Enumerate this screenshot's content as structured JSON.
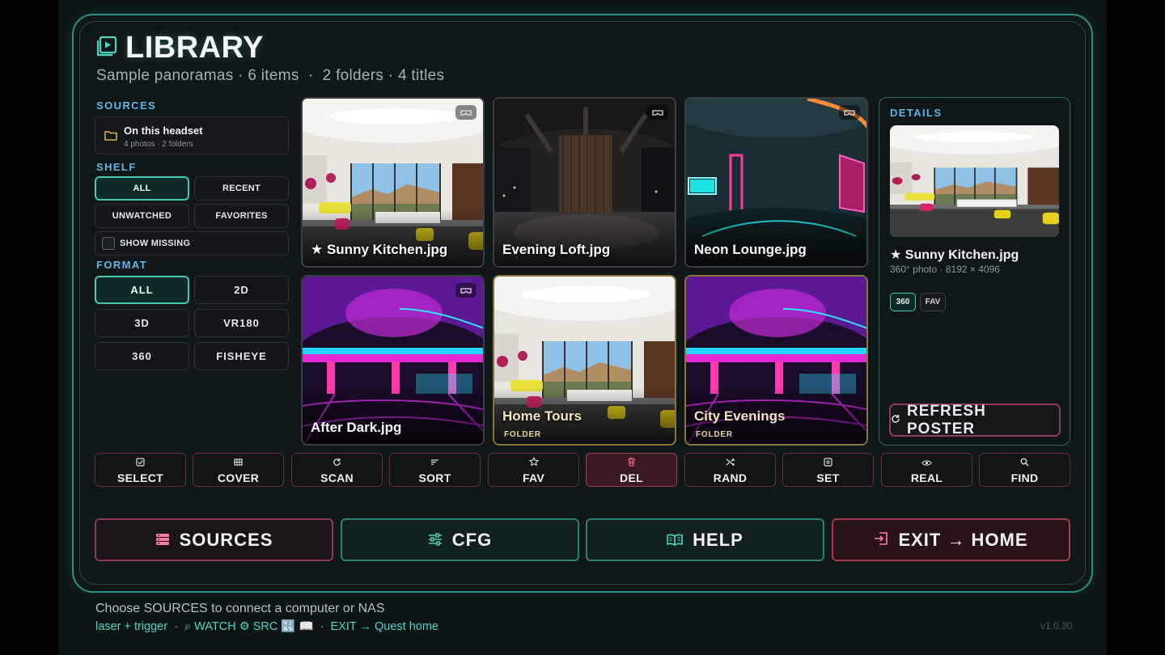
{
  "header": {
    "title": "LIBRARY",
    "subtitle": "Sample panoramas · 6 items  ·  2 folders · 4 titles"
  },
  "sidebar": {
    "sources_label": "SOURCES",
    "source": {
      "name": "On this headset",
      "meta": "4 photos · 2 folders"
    },
    "shelf_label": "SHELF",
    "shelf": [
      {
        "label": "ALL",
        "active": true
      },
      {
        "label": "RECENT",
        "active": false
      },
      {
        "label": "UNWATCHED",
        "active": false
      },
      {
        "label": "FAVORITES",
        "active": false
      }
    ],
    "show_missing": "SHOW MISSING",
    "format_label": "FORMAT",
    "formats": [
      {
        "label": "ALL",
        "active": true
      },
      {
        "label": "2D",
        "active": false
      },
      {
        "label": "3D",
        "active": false
      },
      {
        "label": "VR180",
        "active": false
      },
      {
        "label": "360",
        "active": false
      },
      {
        "label": "FISHEYE",
        "active": false
      }
    ]
  },
  "grid": {
    "items": [
      {
        "title": "★ Sunny Kitchen.jpg",
        "kind": "photo",
        "scene": "kitchen"
      },
      {
        "title": "Evening Loft.jpg",
        "kind": "photo",
        "scene": "loft"
      },
      {
        "title": "Neon Lounge.jpg",
        "kind": "photo",
        "scene": "neon"
      },
      {
        "title": "After Dark.jpg",
        "kind": "photo",
        "scene": "club"
      },
      {
        "title": "Home Tours",
        "kind": "folder",
        "sub": "FOLDER",
        "scene": "kitchen"
      },
      {
        "title": "City Evenings",
        "kind": "folder",
        "sub": "FOLDER",
        "scene": "club"
      }
    ]
  },
  "details": {
    "label": "DETAILS",
    "title": "★ Sunny Kitchen.jpg",
    "meta": "360° photo · 8192 × 4096",
    "tags": [
      "360",
      "FAV"
    ],
    "refresh": "REFRESH POSTER"
  },
  "toolbar": [
    {
      "label": "SELECT",
      "icon": "checkbox-icon"
    },
    {
      "label": "COVER",
      "icon": "grid-icon"
    },
    {
      "label": "SCAN",
      "icon": "refresh-icon"
    },
    {
      "label": "SORT",
      "icon": "sort-icon"
    },
    {
      "label": "FAV",
      "icon": "star-icon"
    },
    {
      "label": "DEL",
      "icon": "trash-icon"
    },
    {
      "label": "RAND",
      "icon": "shuffle-icon"
    },
    {
      "label": "SET",
      "icon": "settings-icon"
    },
    {
      "label": "REAL",
      "icon": "eye-icon"
    },
    {
      "label": "FIND",
      "icon": "search-icon"
    }
  ],
  "nav": [
    {
      "label": "SOURCES",
      "icon": "server-icon"
    },
    {
      "label": "CFG",
      "icon": "sliders-icon"
    },
    {
      "label": "HELP",
      "icon": "book-icon"
    },
    {
      "label": "EXIT → HOME",
      "icon": "exit-icon"
    }
  ],
  "footer": {
    "hint": "Choose SOURCES to connect a computer or NAS",
    "controls": "laser + trigger  ·  ⌕ WATCH ⚙ SRC 🔣 📖  ·  EXIT → Quest home",
    "version": "v1.0.30"
  },
  "colors": {
    "accent": "#45c9b3",
    "label": "#5fb6e6",
    "danger": "#a33b55",
    "folder": "#8a7437"
  }
}
